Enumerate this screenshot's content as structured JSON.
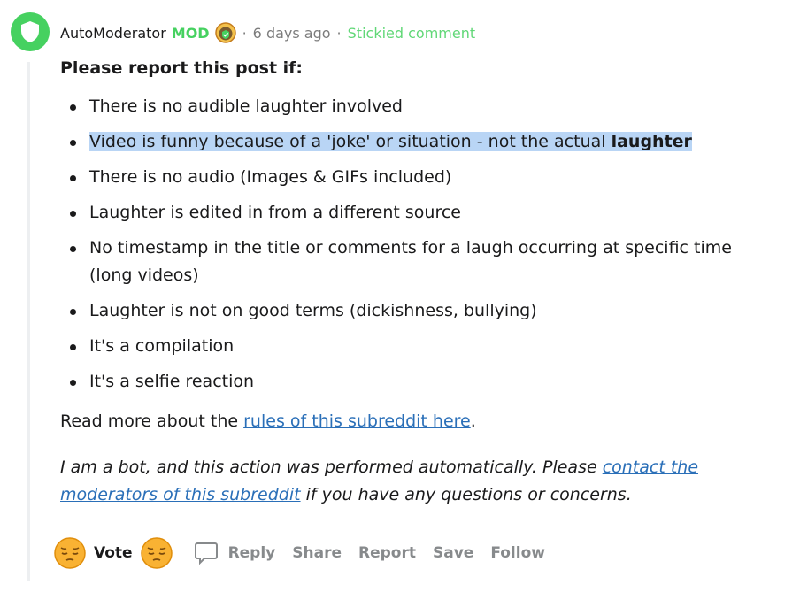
{
  "comment": {
    "author": "AutoModerator",
    "mod_label": "MOD",
    "separator": "·",
    "timestamp": "6 days ago",
    "stickied_label": "Stickied comment",
    "heading": "Please report this post if:",
    "rules": [
      "There is no audible laughter involved",
      "Video is funny because of a 'joke' or situation - not the actual ",
      "There is no audio (Images & GIFs included)",
      "Laughter is edited in from a different source",
      "No timestamp in the title or comments for a laugh occurring at specific time (long videos)",
      "Laughter is not on good terms (dickishness, bullying)",
      "It's a compilation",
      "It's a selfie reaction"
    ],
    "rule_2_bold": "laughter",
    "read_more_prefix": "Read more about the ",
    "read_more_link": "rules of this subreddit here",
    "read_more_suffix": ".",
    "bot_prefix": "I am a bot, and this action was performed automatically. Please ",
    "bot_link": "contact the moderators of this subreddit",
    "bot_suffix": " if you have any questions or concerns."
  },
  "actions": {
    "vote_label": "Vote",
    "reply_label": "Reply",
    "share_label": "Share",
    "report_label": "Report",
    "save_label": "Save",
    "follow_label": "Follow"
  },
  "icons": {
    "avatar": "shield-icon",
    "mod_badge": "mod-badge-icon",
    "upvote": "pensive-face-upvote-icon",
    "downvote": "pensive-face-downvote-icon",
    "reply": "speech-bubble-icon"
  },
  "colors": {
    "mod_green": "#46d160",
    "link_blue": "#2a6fb8",
    "highlight": "#b9d5f5",
    "muted": "#878a8c"
  }
}
